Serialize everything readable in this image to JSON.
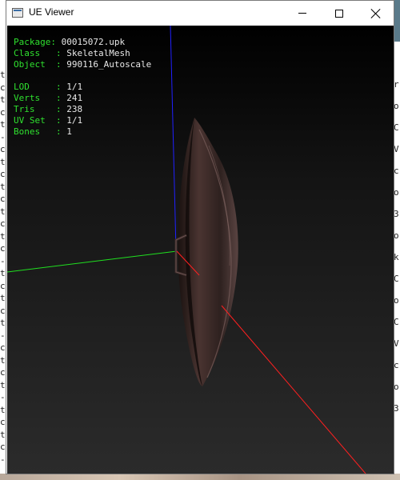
{
  "window": {
    "title": "UE Viewer",
    "icon": "app-window-icon",
    "controls": [
      "minimize-icon",
      "maximize-icon",
      "close-icon"
    ]
  },
  "info": {
    "package_label": "Package: ",
    "package_value": "00015072.upk",
    "class_label": "Class   : ",
    "class_value": "SkeletalMesh",
    "object_label": "Object  : ",
    "object_value": "990116_Autoscale",
    "lod_label": "LOD     : ",
    "lod_value": "1/1",
    "verts_label": "Verts   : ",
    "verts_value": "241",
    "tris_label": "Tris    : ",
    "tris_value": "238",
    "uvset_label": "UV Set  : ",
    "uvset_value": "1/1",
    "bones_label": "Bones   : ",
    "bones_value": "1"
  },
  "background_console": {
    "left_chars": [
      "t",
      "c",
      "t",
      "c",
      "t",
      "-",
      "c",
      "t",
      "c",
      "t",
      "c",
      "t",
      "c",
      "t",
      "c",
      "-",
      "t",
      "c",
      "t",
      "c",
      "t",
      "-",
      "c",
      "t",
      "c",
      "t",
      "-",
      "t",
      "c",
      "t",
      "c",
      "-"
    ],
    "right_chars": [
      "r",
      "o",
      "C",
      "V",
      "c",
      "o",
      "3",
      "o",
      "k",
      "C",
      "o",
      "C",
      "V",
      "c",
      "o",
      "3"
    ]
  },
  "colors": {
    "axis_x": "#ff2020",
    "axis_y": "#20e020",
    "axis_z": "#2020ff",
    "info_label": "#2fe02f",
    "info_value": "#e8e8e8"
  }
}
